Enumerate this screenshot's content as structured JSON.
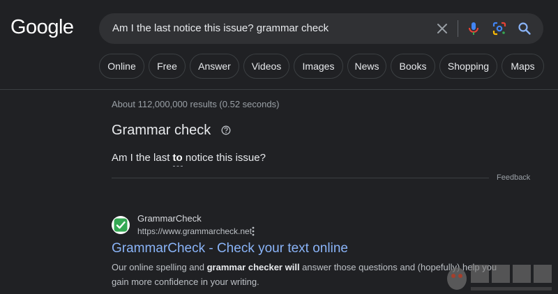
{
  "logo": "Google",
  "search": {
    "query": "Am I the last notice this issue? grammar check"
  },
  "chips": [
    "Online",
    "Free",
    "Answer",
    "Videos",
    "Images",
    "News",
    "Books",
    "Shopping",
    "Maps"
  ],
  "stats": "About 112,000,000 results (0.52 seconds)",
  "grammar": {
    "title": "Grammar check",
    "sentence_before": "Am I the last ",
    "sentence_inserted": "to",
    "sentence_after": " notice this issue?",
    "feedback": "Feedback"
  },
  "result": {
    "site_name": "GrammarCheck",
    "url": "https://www.grammarcheck.net",
    "title": "GrammarCheck - Check your text online",
    "snippet_1": "Our online spelling and ",
    "snippet_bold": "grammar checker will",
    "snippet_2": " answer those questions and (hopefully) help you gain more confidence in your writing."
  },
  "colors": {
    "background": "#202124",
    "link": "#8ab4f8",
    "favicon_green": "#34a853"
  }
}
